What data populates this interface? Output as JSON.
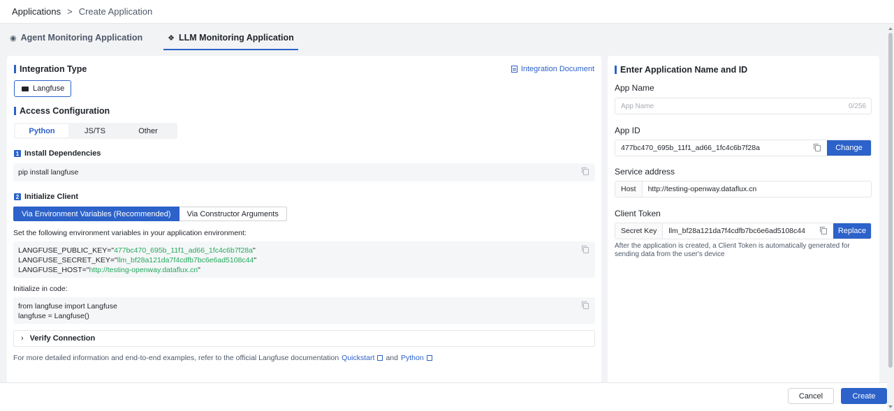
{
  "breadcrumb": {
    "root": "Applications",
    "separator": ">",
    "current": "Create Application"
  },
  "tabs": [
    {
      "label": "Agent Monitoring Application",
      "icon": "robot-icon",
      "active": false
    },
    {
      "label": "LLM Monitoring Application",
      "icon": "llm-icon",
      "active": true
    }
  ],
  "left": {
    "integration_title": "Integration Type",
    "doc_link": "Integration Document",
    "integration_chip": "Langfuse",
    "access_title": "Access Configuration",
    "languages": [
      "Python",
      "JS/TS",
      "Other"
    ],
    "step1": {
      "num": "1",
      "title": "Install Dependencies",
      "code": "pip install langfuse"
    },
    "step2": {
      "num": "2",
      "title": "Initialize Client",
      "options": [
        "Via Environment Variables (Recommended)",
        "Via Constructor Arguments"
      ],
      "env_desc": "Set the following environment variables in your application environment:",
      "env": [
        {
          "key": "LANGFUSE_PUBLIC_KEY=\"",
          "value": "477bc470_695b_11f1_ad66_1fc4c6b7f28a",
          "end": "\""
        },
        {
          "key": "LANGFUSE_SECRET_KEY=\"",
          "value": "llm_bf28a121da7f4cdfb7bc6e6ad5108c44",
          "end": "\""
        },
        {
          "key": "LANGFUSE_HOST=\"",
          "value": "http://testing-openway.dataflux.cn",
          "end": "\""
        }
      ],
      "init_desc": "Initialize in code:",
      "init_code": [
        "from langfuse import Langfuse",
        "langfuse = Langfuse()"
      ]
    },
    "verify": "Verify Connection",
    "footnote": {
      "text": "For more detailed information and end-to-end examples, refer to the official Langfuse documentation",
      "link1": "Quickstart",
      "and": "and",
      "link2": "Python"
    }
  },
  "right": {
    "title": "Enter Application Name and ID",
    "app_name": {
      "label": "App Name",
      "placeholder": "App Name",
      "counter": "0/256"
    },
    "app_id": {
      "label": "App ID",
      "value": "477bc470_695b_11f1_ad66_1fc4c6b7f28a",
      "button": "Change"
    },
    "service": {
      "label": "Service address",
      "addon": "Host",
      "value": "http://testing-openway.dataflux.cn"
    },
    "token": {
      "label": "Client Token",
      "addon": "Secret Key",
      "value": "llm_bf28a121da7f4cdfb7bc6e6ad5108c44",
      "button": "Replace",
      "hint": "After the application is created, a Client Token is automatically generated for sending data from the user's device"
    }
  },
  "footer": {
    "cancel": "Cancel",
    "create": "Create"
  },
  "colors": {
    "accent": "#2c62c9",
    "code_value": "#22a95d"
  }
}
